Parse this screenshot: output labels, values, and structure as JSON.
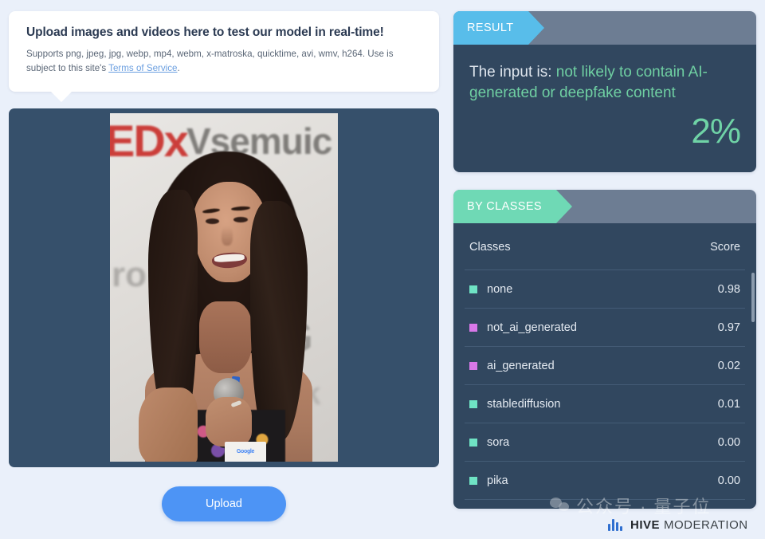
{
  "upload_card": {
    "title": "Upload images and videos here to test our model in real-time!",
    "subtitle_before": "Supports png, jpeg, jpg, webp, mp4, webm, x-matroska, quicktime, avi, wmv, h264. Use is subject to this site's ",
    "terms_link": "Terms of Service",
    "subtitle_after": "."
  },
  "preview": {
    "photo_description": "Smiling woman holding a microphone at a TEDx event",
    "backdrop_text_1": "EDx",
    "backdrop_text_2": "Vsemuic",
    "backdrop_text_3": "ro",
    "backdrop_text_4": "x G",
    "backdrop_text_5": "uk",
    "badge_text": "Google"
  },
  "upload_button": {
    "label": "Upload"
  },
  "result_panel": {
    "tab_label": "RESULT",
    "sentence_prefix": "The input is:",
    "verdict": "not likely to contain AI-generated or deepfake content",
    "score": "2%",
    "accent_color": "#58bdea",
    "verdict_color": "#6fcfa2"
  },
  "by_classes_panel": {
    "tab_label": "BY CLASSES",
    "accent_color": "#6fd9b5",
    "columns": [
      "Classes",
      "Score"
    ],
    "rows": [
      {
        "label": "none",
        "score": "0.98",
        "color": "#6fe3c4"
      },
      {
        "label": "not_ai_generated",
        "score": "0.97",
        "color": "#d878e8"
      },
      {
        "label": "ai_generated",
        "score": "0.02",
        "color": "#d878e8"
      },
      {
        "label": "stablediffusion",
        "score": "0.01",
        "color": "#6fe3c4"
      },
      {
        "label": "sora",
        "score": "0.00",
        "color": "#6fe3c4"
      },
      {
        "label": "pika",
        "score": "0.00",
        "color": "#6fe3c4"
      }
    ]
  },
  "watermark": {
    "text": "公众号 · 量子位"
  },
  "footer_logo": {
    "name": "HIVE",
    "sub": "MODERATION"
  }
}
